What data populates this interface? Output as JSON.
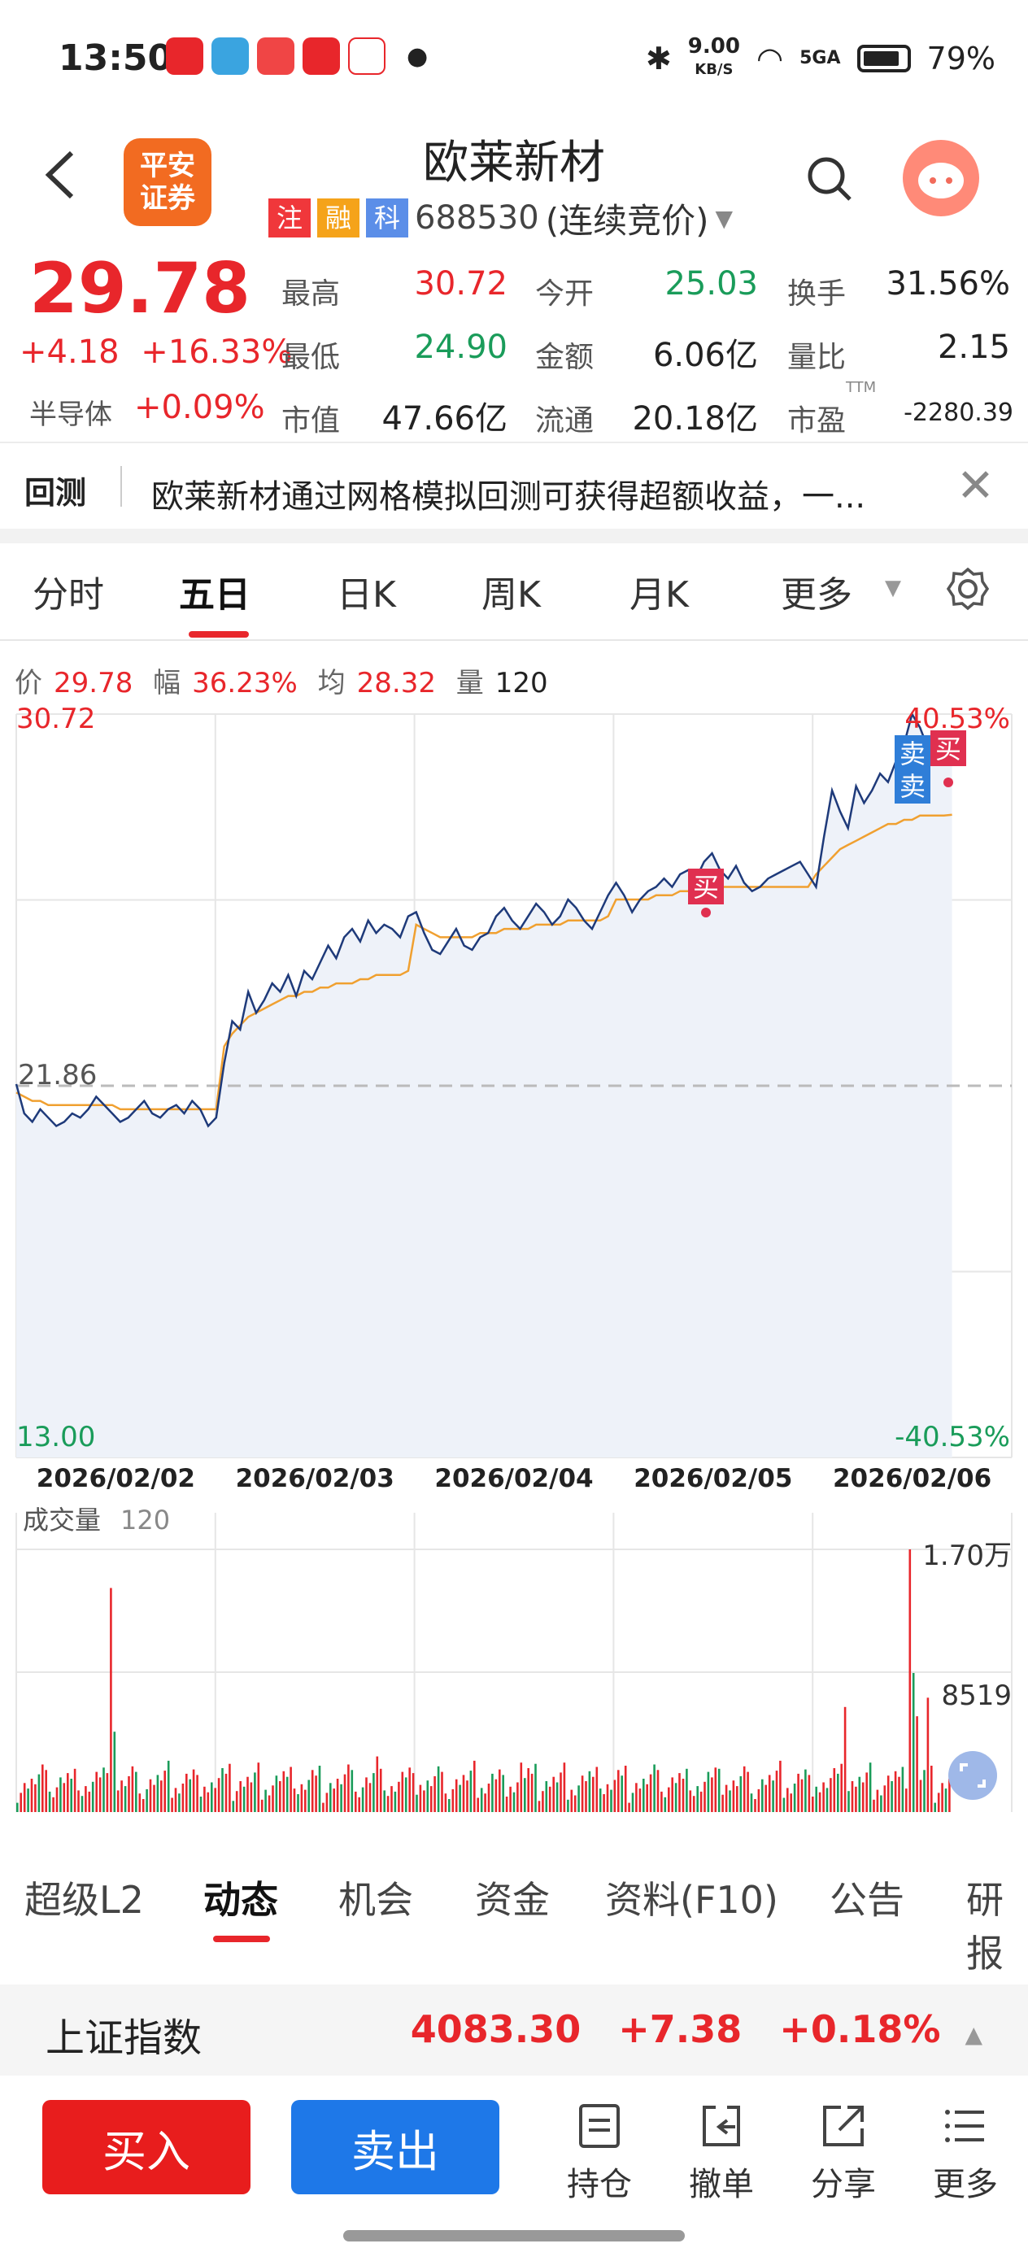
{
  "status_bar": {
    "time": "13:50",
    "net_speed": "9.00",
    "net_unit": "KB/S",
    "signal": "5GA",
    "battery": "79%"
  },
  "header": {
    "back_icon": "chevron-left-icon",
    "logo_text": "平安\n证券",
    "title": "欧莱新材",
    "tags": [
      "注",
      "融",
      "科"
    ],
    "tag_colors": [
      "#f0373b",
      "#f5a31a",
      "#5b8ee8"
    ],
    "code": "688530",
    "trade_mode": "(连续竞价)"
  },
  "quote": {
    "price": "29.78",
    "change": "+4.18",
    "change_pct": "+16.33%",
    "sector": "半导体",
    "sector_chg": "+0.09%",
    "rows": [
      [
        {
          "label": "最高",
          "value": "30.72",
          "color": "red"
        },
        {
          "label": "今开",
          "value": "25.03",
          "color": "green"
        },
        {
          "label": "换手",
          "value": "31.56%",
          "color": "black"
        }
      ],
      [
        {
          "label": "最低",
          "value": "24.90",
          "color": "green"
        },
        {
          "label": "金额",
          "value": "6.06亿",
          "color": "black"
        },
        {
          "label": "量比",
          "value": "2.15",
          "color": "black"
        }
      ],
      [
        {
          "label": "市值",
          "value": "47.66亿",
          "color": "black"
        },
        {
          "label": "流通",
          "value": "20.18亿",
          "color": "black"
        },
        {
          "label": "市盈",
          "value": "-2280.39",
          "color": "black",
          "sup": "TTM"
        }
      ]
    ]
  },
  "notice": {
    "label": "回测",
    "text": "欧莱新材通过网格模拟回测可获得超额收益，一..."
  },
  "period_tabs": [
    "分时",
    "五日",
    "日K",
    "周K",
    "月K",
    "更多"
  ],
  "active_period_tab": "五日",
  "info_row": {
    "price_label": "价",
    "price": "29.78",
    "range_label": "幅",
    "range": "36.23%",
    "avg_label": "均",
    "avg": "28.32",
    "vol_label": "量",
    "vol": "120"
  },
  "chart_data": {
    "type": "line",
    "y_axis_labels": {
      "top": "30.72",
      "mid": "21.86",
      "bottom": "13.00",
      "top_pct": "40.53%",
      "bottom_pct": "-40.53%"
    },
    "ylim": [
      13.0,
      30.72
    ],
    "prev_close": 21.86,
    "x_labels": [
      "2026/02/02",
      "2026/02/03",
      "2026/02/04",
      "2026/02/05",
      "2026/02/06"
    ],
    "series": [
      {
        "values": [
          21.9,
          21.2,
          21.0,
          21.3,
          21.1,
          20.9,
          21.0,
          21.2,
          21.1,
          21.3,
          21.6,
          21.4,
          21.2,
          21.0,
          21.1,
          21.3,
          21.5,
          21.2,
          21.1,
          21.3,
          21.4,
          21.2,
          21.5,
          21.3,
          20.9,
          21.1,
          22.4,
          23.4,
          23.2,
          24.1,
          23.6,
          23.9,
          24.3,
          24.1,
          24.5,
          24.0,
          24.6,
          24.4,
          24.8,
          25.2,
          24.9,
          25.4,
          25.6,
          25.3,
          25.8,
          25.5,
          25.7,
          25.6,
          25.4,
          25.9,
          26.0,
          25.5,
          25.1,
          25.0,
          25.3,
          25.6,
          25.2,
          25.1,
          25.4,
          25.5,
          25.9,
          26.1,
          25.8,
          25.6,
          25.9,
          26.2,
          26.0,
          25.7,
          25.9,
          26.3,
          26.1,
          25.8,
          25.6,
          26.0,
          26.4,
          26.7,
          26.4,
          26.0,
          26.3,
          26.5,
          26.6,
          26.8,
          26.6,
          26.9,
          27.0,
          26.8,
          27.2,
          27.4,
          27.0,
          26.8,
          27.1,
          26.7,
          26.5,
          26.6,
          26.8,
          26.9,
          27.0,
          27.1,
          27.2,
          26.9,
          26.6,
          27.8,
          28.9,
          28.4,
          28.0,
          29.0,
          28.6,
          28.9,
          29.3,
          29.1,
          29.6,
          30.0,
          30.72,
          30.4,
          29.9,
          30.2,
          30.0,
          29.8
        ]
      },
      {
        "values": [
          21.7,
          21.6,
          21.5,
          21.5,
          21.4,
          21.4,
          21.4,
          21.4,
          21.4,
          21.4,
          21.4,
          21.4,
          21.4,
          21.3,
          21.3,
          21.3,
          21.3,
          21.3,
          21.3,
          21.3,
          21.3,
          21.3,
          21.3,
          21.3,
          21.3,
          21.3,
          22.8,
          23.1,
          23.3,
          23.5,
          23.6,
          23.7,
          23.8,
          23.9,
          24.0,
          24.0,
          24.1,
          24.1,
          24.2,
          24.2,
          24.3,
          24.3,
          24.3,
          24.4,
          24.4,
          24.5,
          24.5,
          24.5,
          24.5,
          24.6,
          25.7,
          25.6,
          25.5,
          25.4,
          25.4,
          25.4,
          25.4,
          25.4,
          25.5,
          25.5,
          25.5,
          25.6,
          25.6,
          25.6,
          25.6,
          25.7,
          25.7,
          25.7,
          25.7,
          25.8,
          25.8,
          25.8,
          25.8,
          25.8,
          25.9,
          26.3,
          26.3,
          26.3,
          26.3,
          26.3,
          26.4,
          26.4,
          26.4,
          26.5,
          26.5,
          26.5,
          26.5,
          26.6,
          26.6,
          26.6,
          26.6,
          26.6,
          26.6,
          26.6,
          26.6,
          26.6,
          26.6,
          26.6,
          26.6,
          26.6,
          26.9,
          27.1,
          27.3,
          27.5,
          27.6,
          27.7,
          27.8,
          27.9,
          28.0,
          28.1,
          28.1,
          28.2,
          28.2,
          28.3,
          28.3,
          28.3,
          28.3,
          28.32
        ]
      }
    ],
    "markers": [
      {
        "text": "买",
        "color": "#e03050"
      },
      {
        "text": "卖",
        "color": "#2f7ed8"
      },
      {
        "text": "卖",
        "color": "#2f7ed8"
      },
      {
        "text": "买",
        "color": "#e03050"
      }
    ],
    "volume": {
      "label": "成交量",
      "value": "120",
      "max_label": "1.70万",
      "mid_label": "8519"
    }
  },
  "bottom_tabs": [
    "超级L2",
    "动态",
    "机会",
    "资金",
    "资料(F10)",
    "公告",
    "研报"
  ],
  "active_bottom_tab": "动态",
  "index": {
    "name": "上证指数",
    "value": "4083.30",
    "change": "+7.38",
    "pct": "+0.18%"
  },
  "actions": {
    "buy": "买入",
    "sell": "卖出",
    "items": [
      {
        "label": "持仓",
        "icon": "list-icon"
      },
      {
        "label": "撤单",
        "icon": "undo-icon"
      },
      {
        "label": "分享",
        "icon": "share-icon"
      },
      {
        "label": "更多",
        "icon": "menu-icon"
      }
    ]
  }
}
